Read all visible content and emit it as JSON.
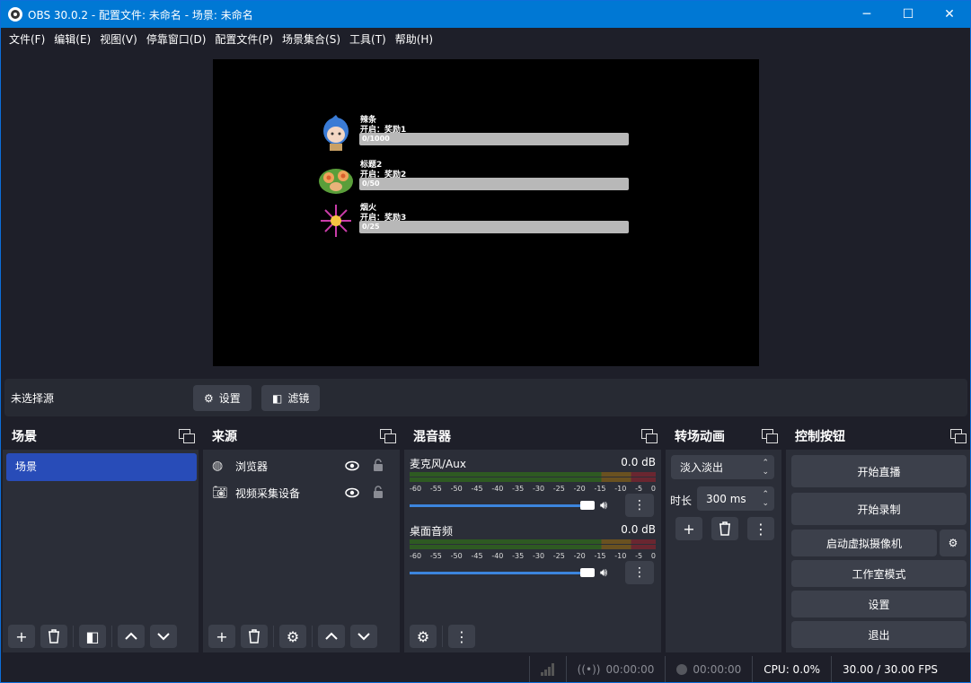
{
  "window": {
    "title": "OBS 30.0.2 - 配置文件: 未命名 - 场景: 未命名",
    "minimize": "─",
    "maximize": "☐",
    "close": "✕"
  },
  "menu": [
    "文件(F)",
    "编辑(E)",
    "视图(V)",
    "停靠窗口(D)",
    "配置文件(P)",
    "场景集合(S)",
    "工具(T)",
    "帮助(H)"
  ],
  "preview": {
    "goals": [
      {
        "name": "辣条",
        "subtitle": "开启：奖励1",
        "progress_text": "0/1000",
        "progress": 0.0,
        "icon": "chibi-avatar",
        "color": "#3a7bd5"
      },
      {
        "name": "标题2",
        "subtitle": "开启：奖励2",
        "progress_text": "0/50",
        "progress": 0.0,
        "icon": "flower-basket",
        "color": "#5a9e3a"
      },
      {
        "name": "烟火",
        "subtitle": "开启：奖励3",
        "progress_text": "0/25",
        "progress": 0.0,
        "icon": "firework",
        "color": "#b5359b"
      }
    ]
  },
  "source_bar": {
    "no_source": "未选择源",
    "settings": "设置",
    "filters": "滤镜"
  },
  "scenes": {
    "title": "场景",
    "items": [
      "场景"
    ]
  },
  "sources": {
    "title": "来源",
    "items": [
      {
        "label": "浏览器",
        "icon": "globe-icon"
      },
      {
        "label": "视频采集设备",
        "icon": "camera-icon"
      }
    ]
  },
  "mixer": {
    "title": "混音器",
    "ticks": [
      "-60",
      "-55",
      "-50",
      "-45",
      "-40",
      "-35",
      "-30",
      "-25",
      "-20",
      "-15",
      "-10",
      "-5",
      "0"
    ],
    "channels": [
      {
        "name": "麦克风/Aux",
        "db": "0.0 dB",
        "volume": 1.0
      },
      {
        "name": "桌面音频",
        "db": "0.0 dB",
        "volume": 1.0
      }
    ]
  },
  "transitions": {
    "title": "转场动画",
    "selected": "淡入淡出",
    "duration_label": "时长",
    "duration_value": "300 ms"
  },
  "controls": {
    "title": "控制按钮",
    "start_stream": "开始直播",
    "start_record": "开始录制",
    "virtual_cam": "启动虚拟摄像机",
    "studio_mode": "工作室模式",
    "settings": "设置",
    "exit": "退出"
  },
  "status": {
    "stream_time": "00:00:00",
    "record_time": "00:00:00",
    "cpu": "CPU: 0.0%",
    "fps": "30.00 / 30.00 FPS"
  }
}
